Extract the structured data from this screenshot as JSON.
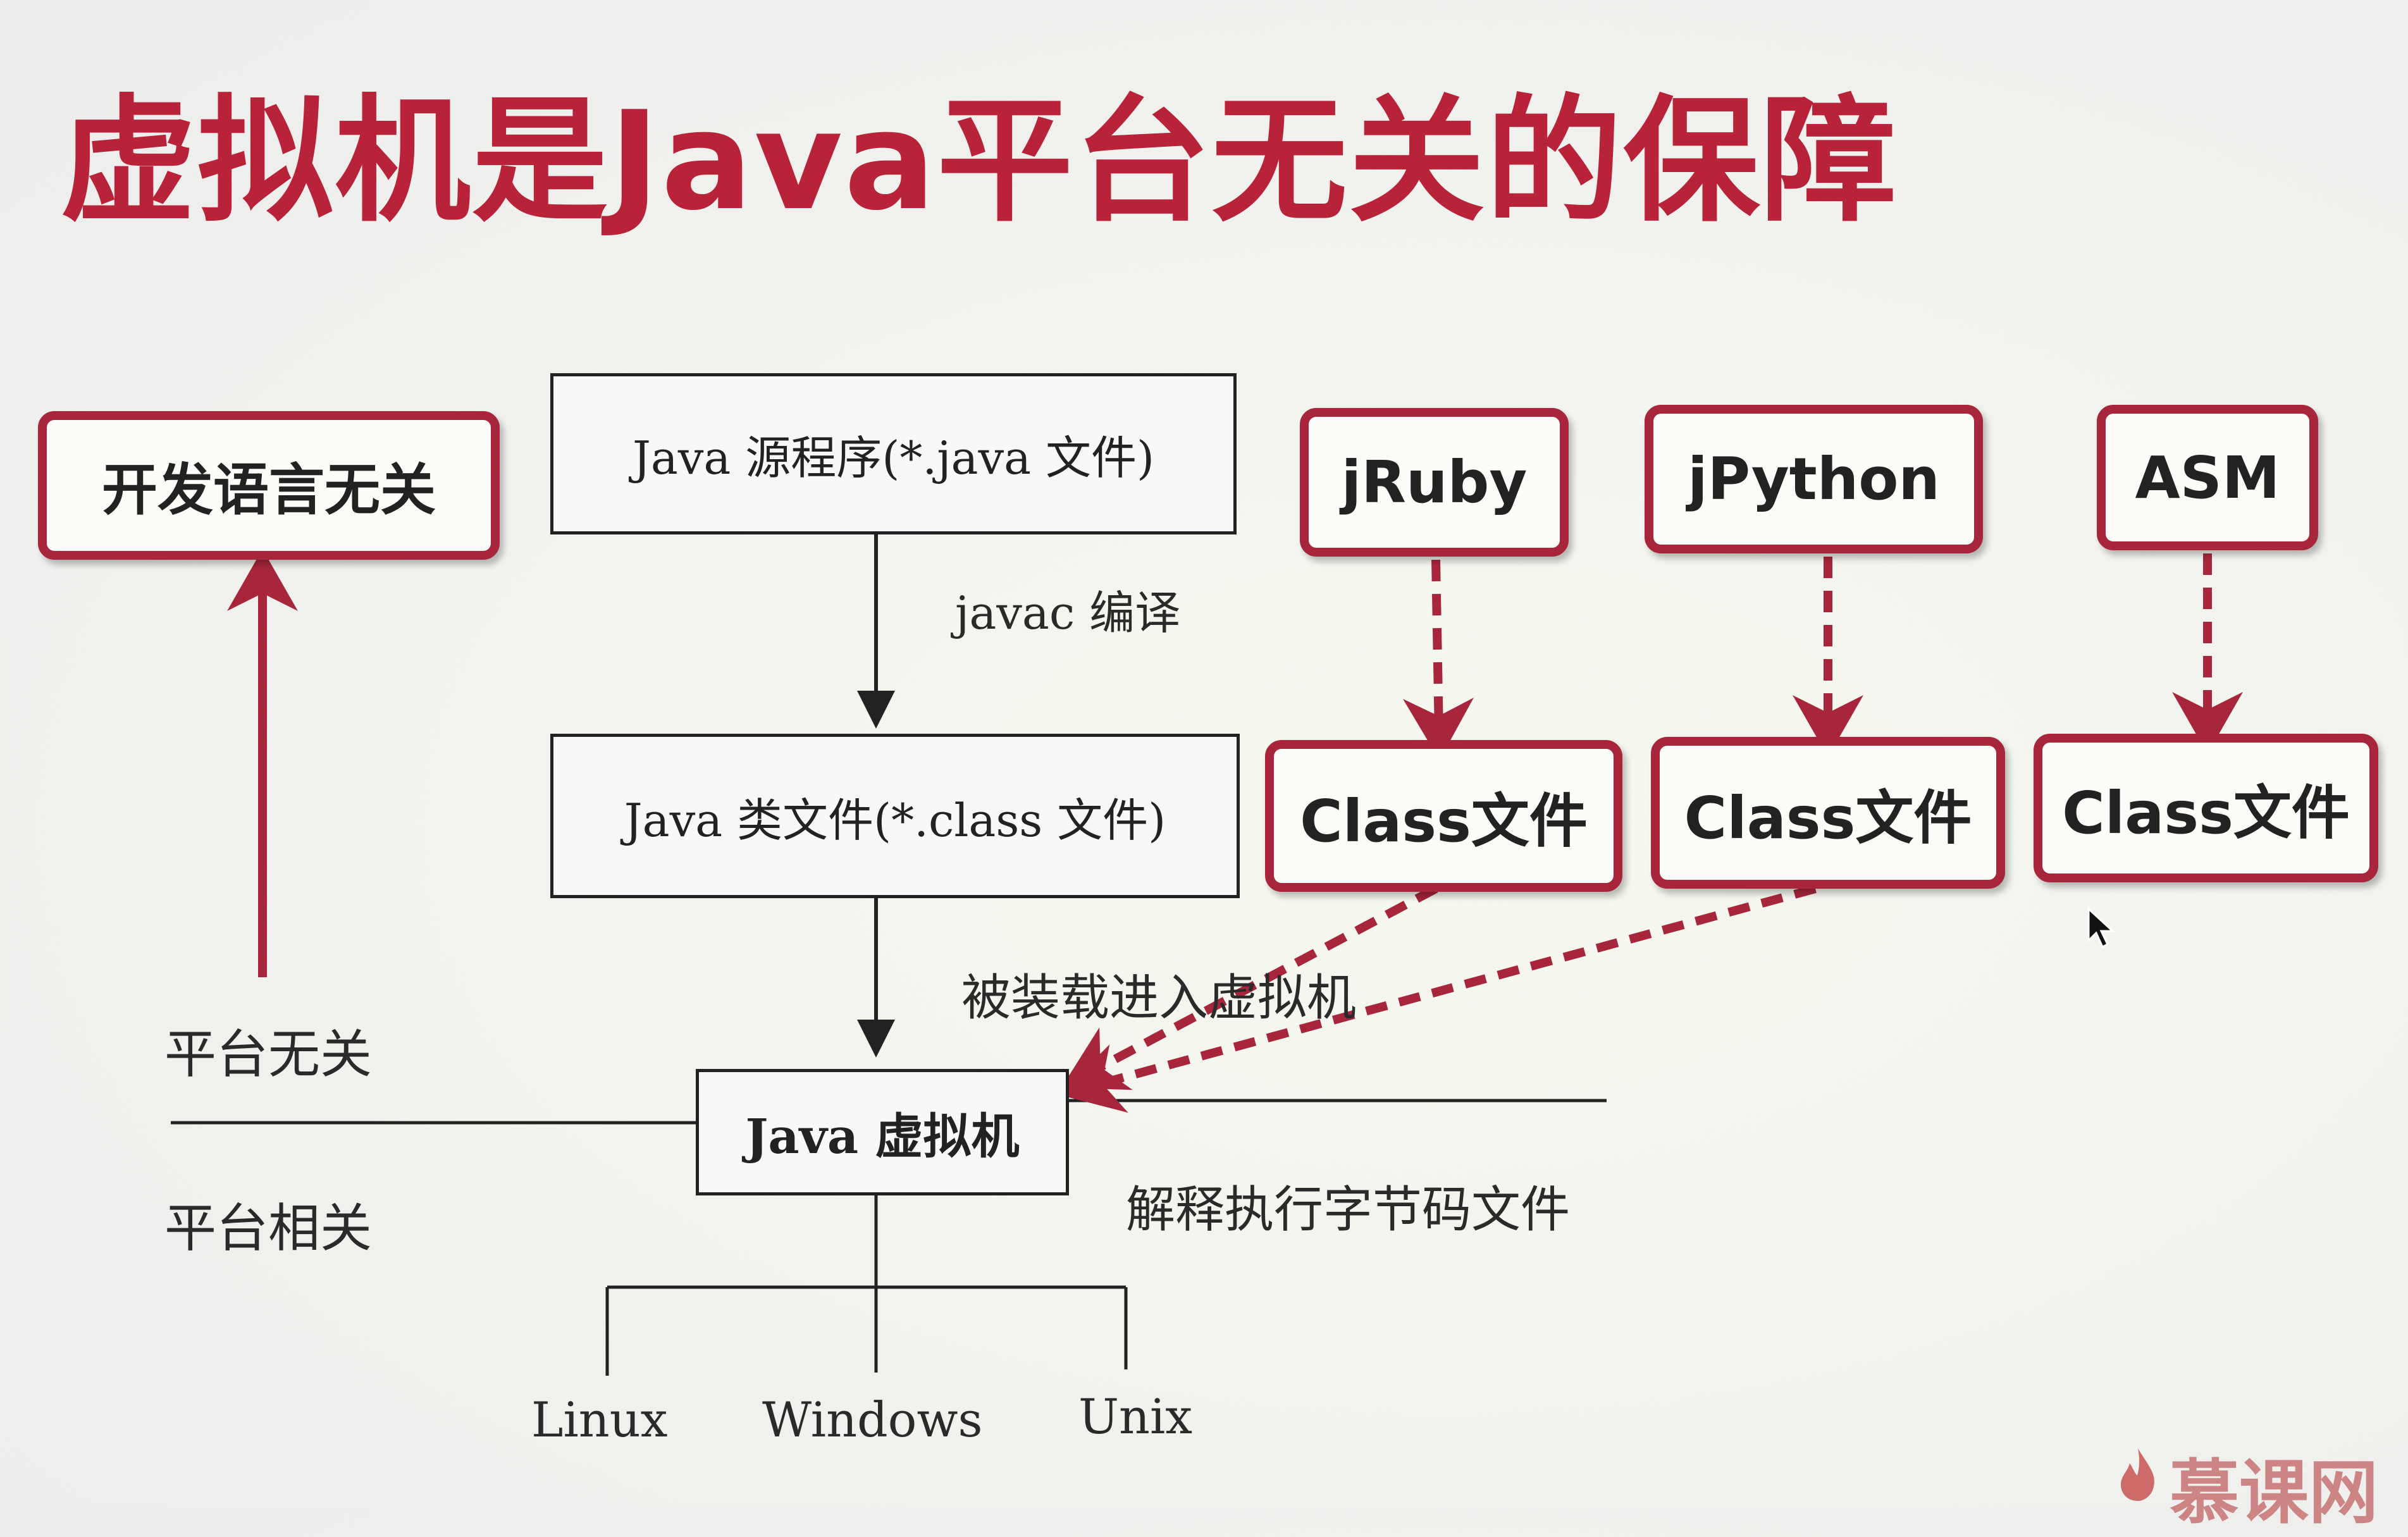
{
  "title": "虚拟机是Java平台无关的保障",
  "left": {
    "language_box": "开发语言无关",
    "platform_independent": "平台无关",
    "platform_dependent": "平台相关"
  },
  "flow": {
    "source_box": "Java 源程序(*.java 文件)",
    "compile_label": "javac 编译",
    "class_box": "Java 类文件(*.class 文件)",
    "load_label": "被装载进入虚拟机",
    "jvm_box": "Java 虚拟机",
    "interpret_label": "解释执行字节码文件"
  },
  "languages": [
    {
      "name": "jRuby",
      "output": "Class文件"
    },
    {
      "name": "jPython",
      "output": "Class文件"
    },
    {
      "name": "ASM",
      "output": "Class文件"
    }
  ],
  "platforms": [
    "Linux",
    "Windows",
    "Unix"
  ],
  "watermark": "慕课网",
  "colors": {
    "accent": "#b8233a",
    "box_border": "#a8263b",
    "line": "#222222"
  }
}
